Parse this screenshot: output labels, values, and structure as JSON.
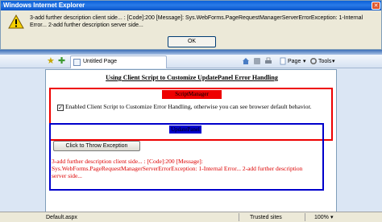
{
  "dialog": {
    "title": "Windows Internet Explorer",
    "message": "3-add further description client side... : [Code]:200  [Message]: Sys.WebForms.PageRequestManagerServerErrorException: 1-Internal Error... 2-add further description server side...",
    "ok_label": "OK",
    "icon": "warning-icon"
  },
  "browser": {
    "tab_title": "Untitled Page",
    "page_menu": "Page",
    "tools_menu": "Tools",
    "status_left": "Default.aspx",
    "status_zone": "Trusted sites",
    "zoom": "100%"
  },
  "page": {
    "heading": "Using Client Script to Customize UpdatePanel Error Handling",
    "script_manager_label": "ScriptManager",
    "checkbox_label": "Enabled Client Script to Customize Error Handling, otherwise you can see browser default behavior.",
    "checkbox_checked": true,
    "update_panel_label": "UpdatePanel",
    "throw_button": "Click to Throw Exception",
    "error_text": "3-add further description client side... : [Code]:200  [Message]: Sys.WebForms.PageRequestManagerServerErrorException: 1-Internal Error... 2-add further description server side..."
  },
  "colors": {
    "script_manager_border": "#ee0000",
    "update_panel_border": "#0000cc",
    "error_text": "#dd0000"
  }
}
